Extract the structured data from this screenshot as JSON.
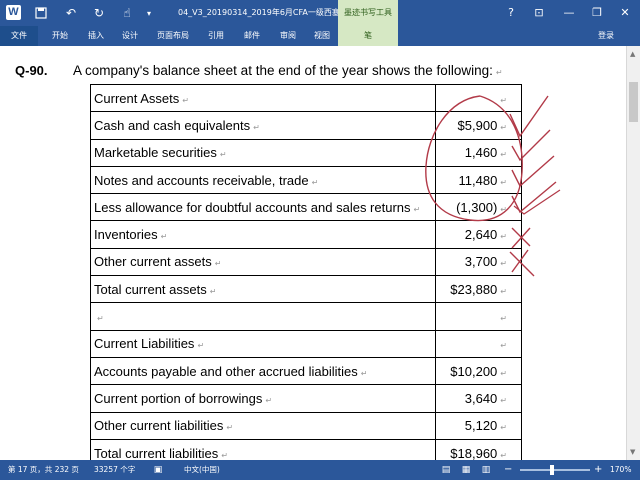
{
  "titlebar": {
    "app_icon": "W",
    "doc_title": "04_V3_20190314_2019年6月CFA一级西塞视...",
    "context_header": "墨迹书写工具",
    "icons": [
      "save-icon",
      "undo-icon",
      "redo-icon",
      "touch-mode-icon",
      "customize-icon"
    ],
    "controls": {
      "help": "?",
      "ribbon_options": "⊡",
      "minimize": "—",
      "restore": "❐",
      "close": "✕"
    }
  },
  "ribbon": {
    "tabs": [
      "文件",
      "开始",
      "插入",
      "设计",
      "页面布局",
      "引用",
      "邮件",
      "审阅",
      "视图",
      "笔"
    ],
    "signin": "登录"
  },
  "document": {
    "question_number": "Q-90.",
    "question_text": "A company's balance sheet at the end of the year shows the following:",
    "pmark": "↵",
    "rows": [
      {
        "label": "Current Assets",
        "value": ""
      },
      {
        "label": "Cash and cash equivalents",
        "value": "$5,900"
      },
      {
        "label": "Marketable securities",
        "value": "1,460"
      },
      {
        "label": "Notes and accounts receivable, trade",
        "value": "11,480"
      },
      {
        "label": "Less allowance for doubtful accounts and sales returns",
        "value": "(1,300)"
      },
      {
        "label": "Inventories",
        "value": "2,640"
      },
      {
        "label": "Other current assets",
        "value": "3,700"
      },
      {
        "label": "Total current assets",
        "value": "$23,880"
      },
      {
        "label": "",
        "value": ""
      },
      {
        "label": "Current Liabilities",
        "value": ""
      },
      {
        "label": "Accounts payable and other accrued liabilities",
        "value": "$10,200"
      },
      {
        "label": "Current portion of borrowings",
        "value": "3,640"
      },
      {
        "label": "Other current liabilities",
        "value": "5,120"
      },
      {
        "label": "Total current liabilities",
        "value": "$18,960"
      }
    ]
  },
  "statusbar": {
    "page_info": "第 17 页，共 232 页",
    "word_count": "33257 个字",
    "language": "中文(中国)",
    "zoom_minus": "−",
    "zoom_plus": "+",
    "zoom": "170%",
    "zoom_level": 0.45
  }
}
